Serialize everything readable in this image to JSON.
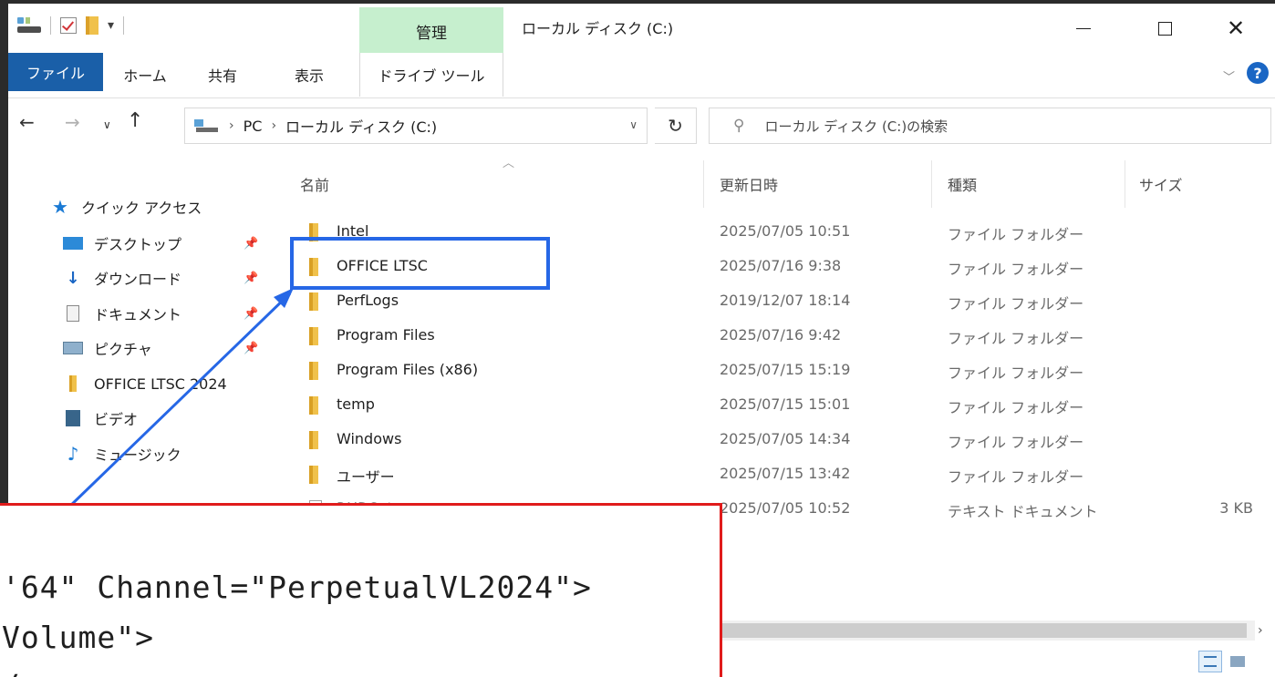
{
  "title_bar": {
    "context_tab": "管理",
    "window_title": "ローカル ディスク (C:)"
  },
  "ribbon": {
    "tabs": [
      "ファイル",
      "ホーム",
      "共有",
      "表示",
      "ドライブ ツール"
    ]
  },
  "address_bar": {
    "crumbs": [
      "PC",
      "ローカル ディスク (C:)"
    ],
    "search_placeholder": "ローカル ディスク (C:)の検索"
  },
  "nav_pane": {
    "quick_access": "クイック アクセス",
    "items": [
      {
        "label": "デスクトップ",
        "icon": "desktop-icon",
        "pinned": true
      },
      {
        "label": "ダウンロード",
        "icon": "download-icon",
        "pinned": true
      },
      {
        "label": "ドキュメント",
        "icon": "document-icon",
        "pinned": true
      },
      {
        "label": "ピクチャ",
        "icon": "picture-icon",
        "pinned": true
      },
      {
        "label": "OFFICE LTSC 2024",
        "icon": "folder-icon",
        "pinned": false
      },
      {
        "label": "ビデオ",
        "icon": "video-icon",
        "pinned": false
      },
      {
        "label": "ミュージック",
        "icon": "music-icon",
        "pinned": false
      }
    ]
  },
  "file_list": {
    "columns": [
      "名前",
      "更新日時",
      "種類",
      "サイズ"
    ],
    "rows": [
      {
        "name": "Intel",
        "date": "2025/07/05 10:51",
        "type": "ファイル フォルダー",
        "size": ""
      },
      {
        "name": "OFFICE LTSC",
        "date": "2025/07/16 9:38",
        "type": "ファイル フォルダー",
        "size": ""
      },
      {
        "name": "PerfLogs",
        "date": "2019/12/07 18:14",
        "type": "ファイル フォルダー",
        "size": ""
      },
      {
        "name": "Program Files",
        "date": "2025/07/16 9:42",
        "type": "ファイル フォルダー",
        "size": ""
      },
      {
        "name": "Program Files (x86)",
        "date": "2025/07/15 15:19",
        "type": "ファイル フォルダー",
        "size": ""
      },
      {
        "name": "temp",
        "date": "2025/07/15 15:01",
        "type": "ファイル フォルダー",
        "size": ""
      },
      {
        "name": "Windows",
        "date": "2025/07/05 14:34",
        "type": "ファイル フォルダー",
        "size": ""
      },
      {
        "name": "ユーザー",
        "date": "2025/07/15 13:42",
        "type": "ファイル フォルダー",
        "size": ""
      },
      {
        "name": "RHDSetup",
        "date": "2025/07/05 10:52",
        "type": "テキスト ドキュメント",
        "size": "3 KB"
      }
    ]
  },
  "callout": {
    "line1": "'64\" Channel=\"PerpetualVL2024\">",
    "line2": "Volume\">",
    "line3": "/"
  },
  "colors": {
    "highlight_box": "#2667e6",
    "callout_border": "#e01b1b",
    "ribbon_file_tab": "#1a5fa8",
    "context_tab": "#c6efce"
  }
}
